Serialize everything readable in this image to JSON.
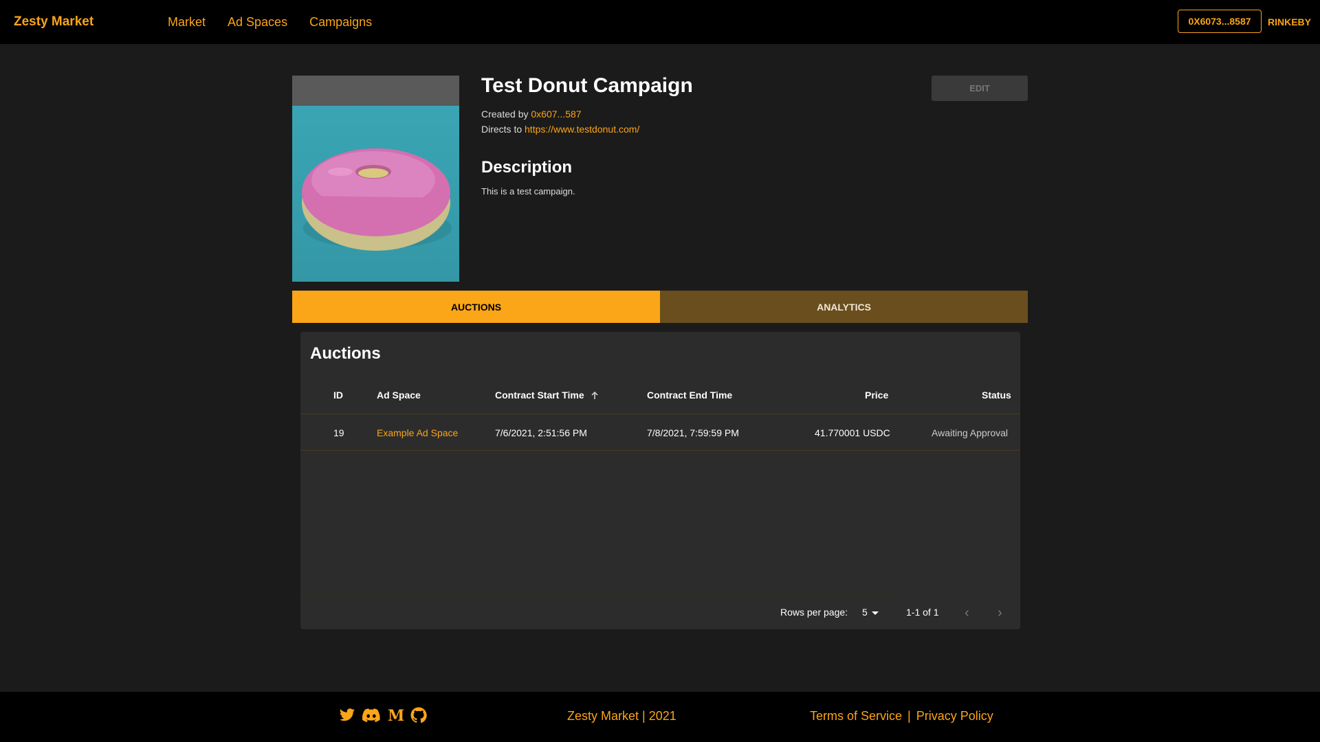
{
  "header": {
    "brand": "Zesty Market",
    "nav": [
      "Market",
      "Ad Spaces",
      "Campaigns"
    ],
    "wallet": "0X6073...8587",
    "network": "RINKEBY"
  },
  "campaign": {
    "title": "Test Donut Campaign",
    "created_by_label": "Created by ",
    "created_by": "0x607...587",
    "directs_to_label": "Directs to ",
    "directs_to": "https://www.testdonut.com/",
    "description_heading": "Description",
    "description": "This is a test campaign.",
    "edit_label": "EDIT"
  },
  "tabs": [
    {
      "label": "AUCTIONS",
      "active": true
    },
    {
      "label": "ANALYTICS",
      "active": false
    }
  ],
  "auctions": {
    "title": "Auctions",
    "columns": [
      "ID",
      "Ad Space",
      "Contract Start Time",
      "Contract End Time",
      "Price",
      "Status"
    ],
    "rows": [
      {
        "id": "19",
        "ad_space": "Example Ad Space",
        "start": "7/6/2021, 2:51:56 PM",
        "end": "7/8/2021, 7:59:59 PM",
        "price": "41.770001 USDC",
        "status": "Awaiting Approval"
      }
    ],
    "rows_per_page_label": "Rows per page:",
    "rows_per_page": "5",
    "range": "1-1 of 1"
  },
  "footer": {
    "copyright": "Zesty Market | 2021",
    "terms": "Terms of Service",
    "separator": "|",
    "privacy": "Privacy Policy"
  },
  "colors": {
    "accent": "#fba518",
    "background": "#1b1b1b",
    "card": "#2c2c2c"
  }
}
